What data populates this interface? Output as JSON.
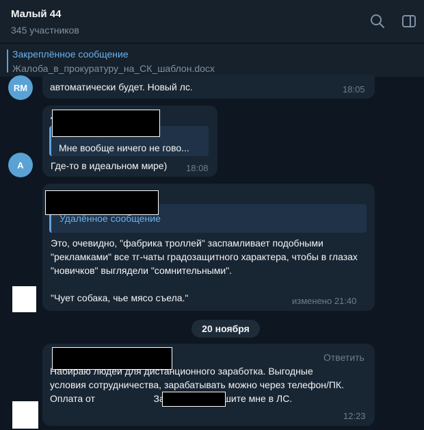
{
  "header": {
    "title": "Малый 44",
    "members": "345 участников"
  },
  "pinned": {
    "title": "Закреплённое сообщение",
    "text": "Жалоба_в_прокуратуру_на_СК_шаблон.docx"
  },
  "messages": [
    {
      "avatar": "RM",
      "text": "автоматически будет. Новый лс.",
      "time": "18:05"
    },
    {
      "avatar": "A",
      "quote": "Мне вообще ничего не гово...",
      "text": "Где-то в идеальном мире)",
      "time": "18:08"
    },
    {
      "deleted_label": "Удалённое сообщение",
      "text": "Это, очевидно, \"фабрика троллей\" заспамливает подобными \"рекламками\" все тг-чаты градозащитного характера, чтобы в глазах  \"новичков\" выглядели \"сомнительными\".\n\n\"Чует собака, чье мясо съела.\"",
      "time": "изменено 21:40"
    },
    {
      "reply": "Ответить",
      "text": "Набираю людей для дистанционного заработка. Выгодные условия сотрудничества, зарабатывать можно через телефон/ПК. Оплата от                      За деталями пишите мне в ЛС.",
      "time": "12:23"
    }
  ],
  "date_separator": "20 ноября",
  "colors": {
    "accent": "#6ab2f2",
    "bubble": "#182533",
    "background": "#0e1621"
  }
}
